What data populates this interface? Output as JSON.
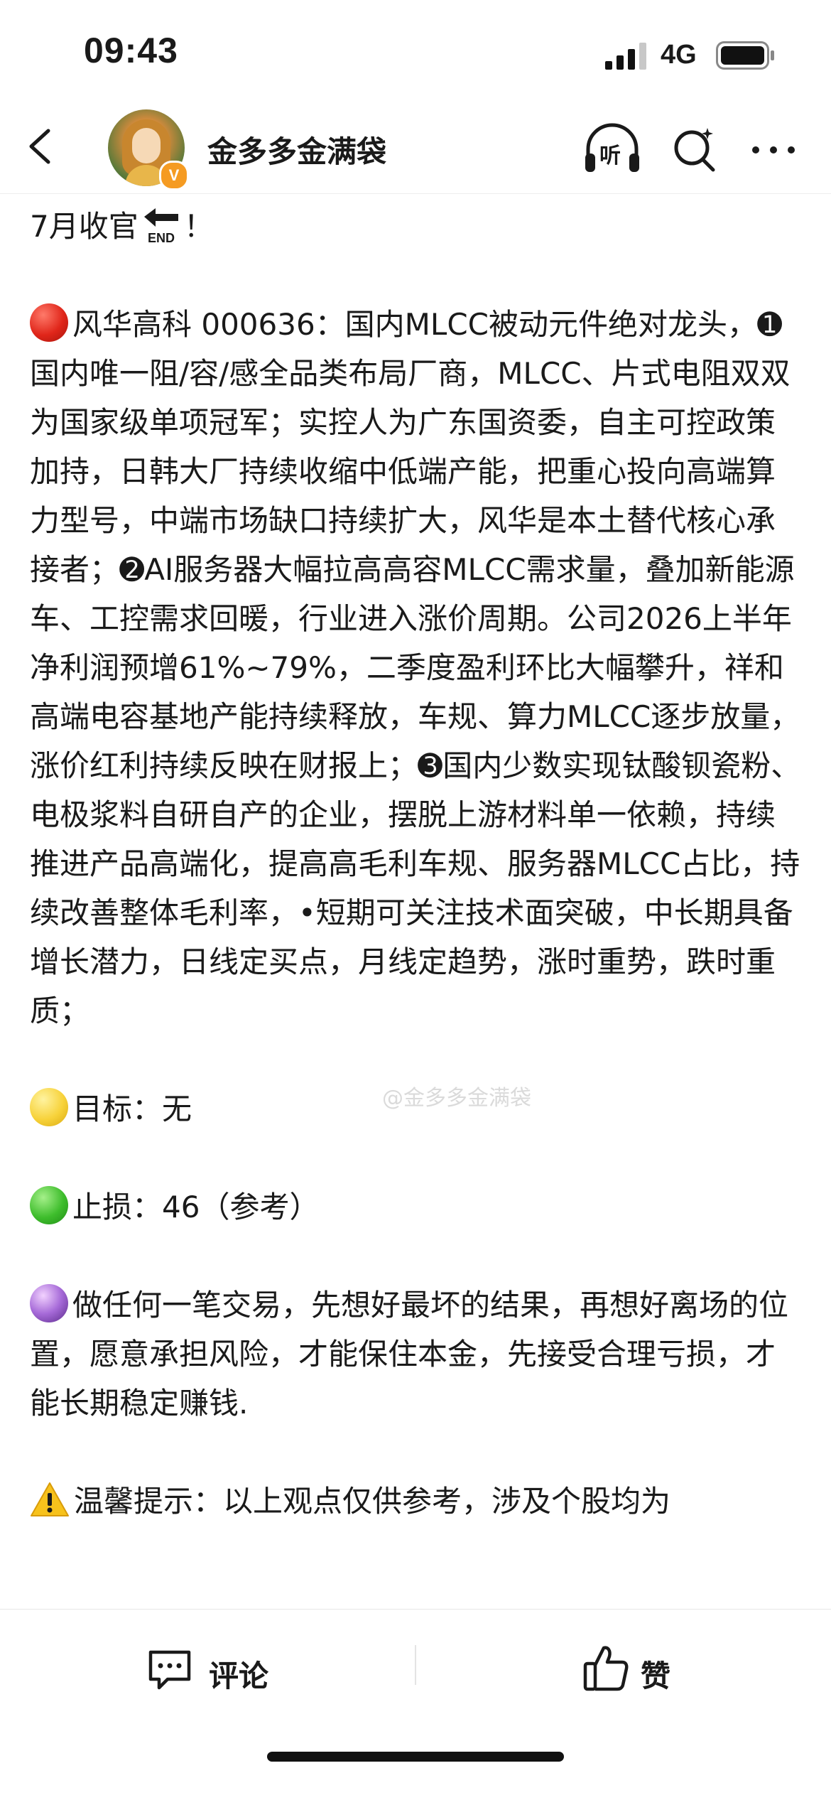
{
  "status_bar": {
    "time": "09:43",
    "network": "4G"
  },
  "nav": {
    "account_name": "金多多金满袋",
    "listen_label": "听",
    "verified_mark": "V"
  },
  "post": {
    "title_prefix": "7月收官",
    "title_suffix": "！",
    "end_icon_text": "END",
    "p1_text": "风华高科 000636：国内MLCC被动元件绝对龙头，➊国内唯一阻/容/感全品类布局厂商，MLCC、片式电阻双双为国家级单项冠军；实控人为广东国资委，自主可控政策加持，日韩大厂持续收缩中低端产能，把重心投向高端算力型号，中端市场缺口持续扩大，风华是本土替代核心承接者；➋AI服务器大幅拉高高容MLCC需求量，叠加新能源车、工控需求回暖，行业进入涨价周期。公司2026上半年净利润预增61%~79%，二季度盈利环比大幅攀升，祥和高端电容基地产能持续释放，车规、算力MLCC逐步放量，涨价红利持续反映在财报上；➌国内少数实现钛酸钡瓷粉、电极浆料自研自产的企业，摆脱上游材料单一依赖，持续推进产品高端化，提高高毛利车规、服务器MLCC占比，持续改善整体毛利率，•短期可关注技术面突破，中长期具备增长潜力，日线定买点，月线定趋势，涨时重势，跌时重质；",
    "target_text": "目标：无",
    "stoploss_text": "止损：46（参考）",
    "advice_text": "做任何一笔交易，先想好最坏的结果，再想好离场的位置，愿意承担风险，才能保住本金，先接受合理亏损，才能长期稳定赚钱.",
    "warning_text": "温馨提示：以上观点仅供参考，涉及个股均为",
    "watermark": "@金多多金满袋"
  },
  "bottom_bar": {
    "comment_label": "评论",
    "like_label": "赞"
  },
  "icons": {
    "back": "chevron-left-icon",
    "listen": "headphones-icon",
    "search": "search-sparkle-icon",
    "more": "more-dots-icon",
    "comment": "comment-bubble-icon",
    "like": "thumbs-up-icon"
  },
  "colors": {
    "text": "#1a1a1a",
    "verified_badge": "#f59b22",
    "red_dot": "#e0261a",
    "yellow_dot": "#f7d23a",
    "green_dot": "#3ebd2c"
  }
}
